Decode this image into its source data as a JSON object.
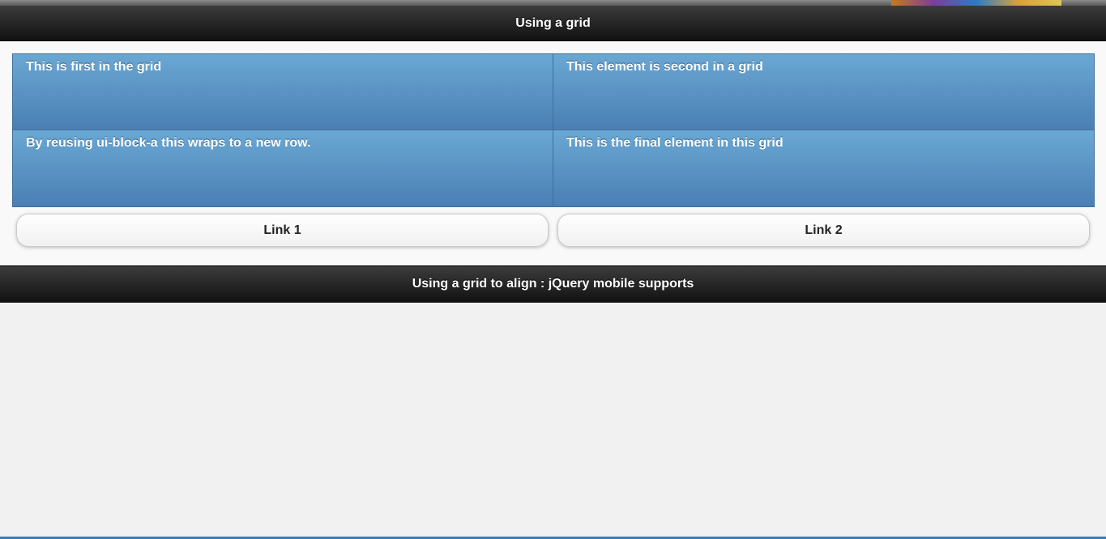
{
  "header": {
    "title": "Using a grid"
  },
  "grid": {
    "cells": [
      "This is first in the grid",
      "This element is second in a grid",
      "By reusing ui-block-a this wraps to a new row.",
      "This is the final element in this grid"
    ]
  },
  "buttons": {
    "link1": "Link 1",
    "link2": "Link 2"
  },
  "footer": {
    "title": "Using a grid to align : jQuery mobile supports"
  },
  "colors": {
    "bar_dark": "#111111",
    "cell_blue_top": "#6aa8d4",
    "cell_blue_bottom": "#4a7fb3",
    "page_bg": "#f1f1f1"
  }
}
